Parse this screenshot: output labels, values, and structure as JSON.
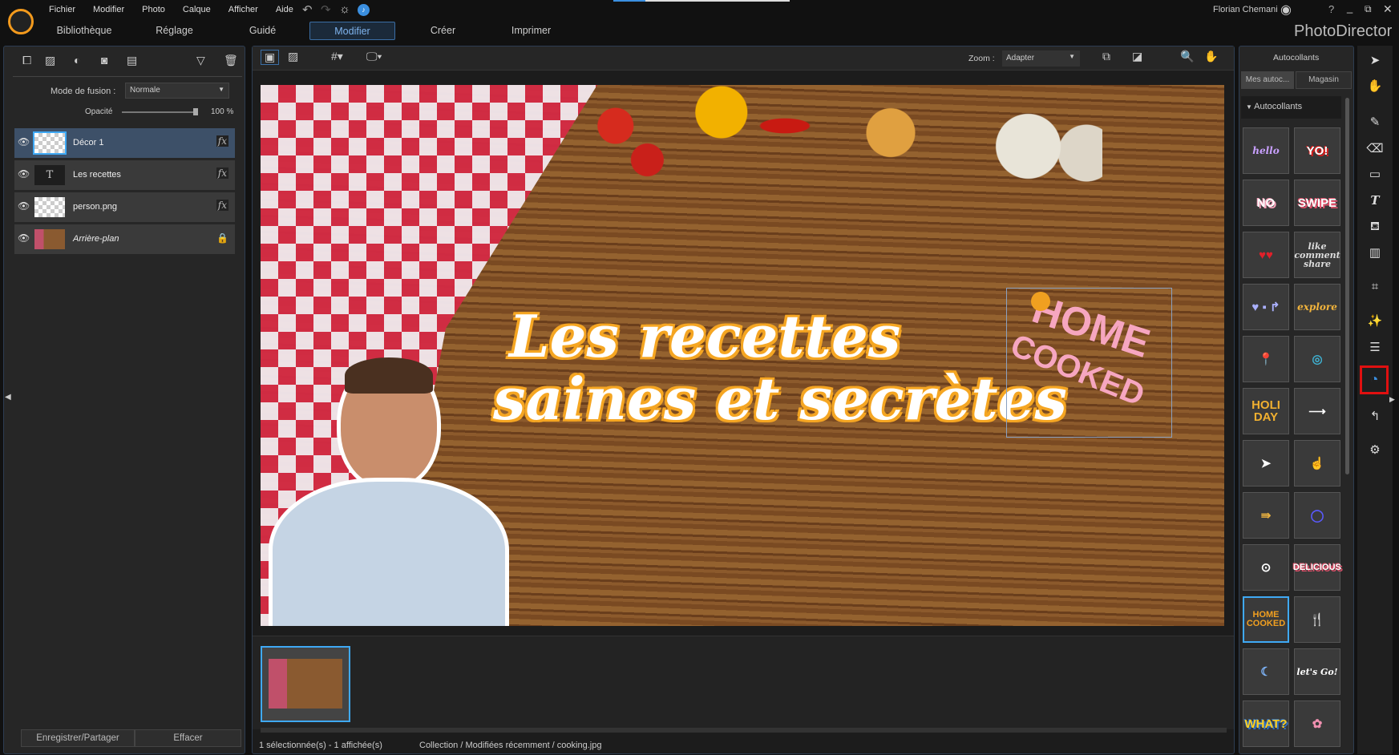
{
  "app": {
    "title": "PhotoDirector",
    "user": "Florian Chemani"
  },
  "menu": [
    "Fichier",
    "Modifier",
    "Photo",
    "Calque",
    "Afficher",
    "Aide"
  ],
  "tabs": [
    {
      "label": "Bibliothèque"
    },
    {
      "label": "Réglage"
    },
    {
      "label": "Guidé"
    },
    {
      "label": "Modifier",
      "active": true
    },
    {
      "label": "Créer"
    },
    {
      "label": "Imprimer"
    }
  ],
  "layers_panel": {
    "blend_label": "Mode de fusion :",
    "blend_value": "Normale",
    "opacity_label": "Opacité",
    "opacity_value": "100 %",
    "opacity": 100,
    "layers": [
      {
        "name": "Décor 1",
        "selected": true,
        "badge": "fx"
      },
      {
        "name": "Les recettes",
        "badge": "fx",
        "thumb": "T"
      },
      {
        "name": "person.png",
        "badge": "fx"
      },
      {
        "name": "Arrière-plan",
        "badge": "lock"
      }
    ],
    "save_button": "Enregistrer/Partager",
    "clear_button": "Effacer"
  },
  "canvas": {
    "zoom_label": "Zoom :",
    "zoom_value": "Adapter",
    "text_line1": "Les recettes",
    "text_line2": "saines et secrètes",
    "sticker_line1": "HOME",
    "sticker_line2": "COOKED"
  },
  "status": {
    "selection": "1 sélectionnée(s) - 1 affichée(s)",
    "path": "Collection / Modifiées récemment / cooking.jpg"
  },
  "stickers_panel": {
    "title": "Autocollants",
    "tab_mine": "Mes autoc...",
    "tab_store": "Magasin",
    "section": "Autocollants",
    "items": [
      "hello",
      "YO!",
      "NO",
      "SWIPE",
      "♥♥",
      "like comment share",
      "♥ ▪ ↱",
      "explore",
      "📍",
      "◎",
      "HOLI DAY",
      "⟶",
      "➤",
      "☝",
      "⇛",
      "◯",
      "⊙",
      "DELICIOUS",
      "HOME COOKED",
      "🍴",
      "☾",
      "let's Go!",
      "WHAT?",
      "✿"
    ]
  },
  "colors": {
    "accent": "#3b8fe0",
    "highlight": "#e01010",
    "text_orange": "#f5a623"
  }
}
